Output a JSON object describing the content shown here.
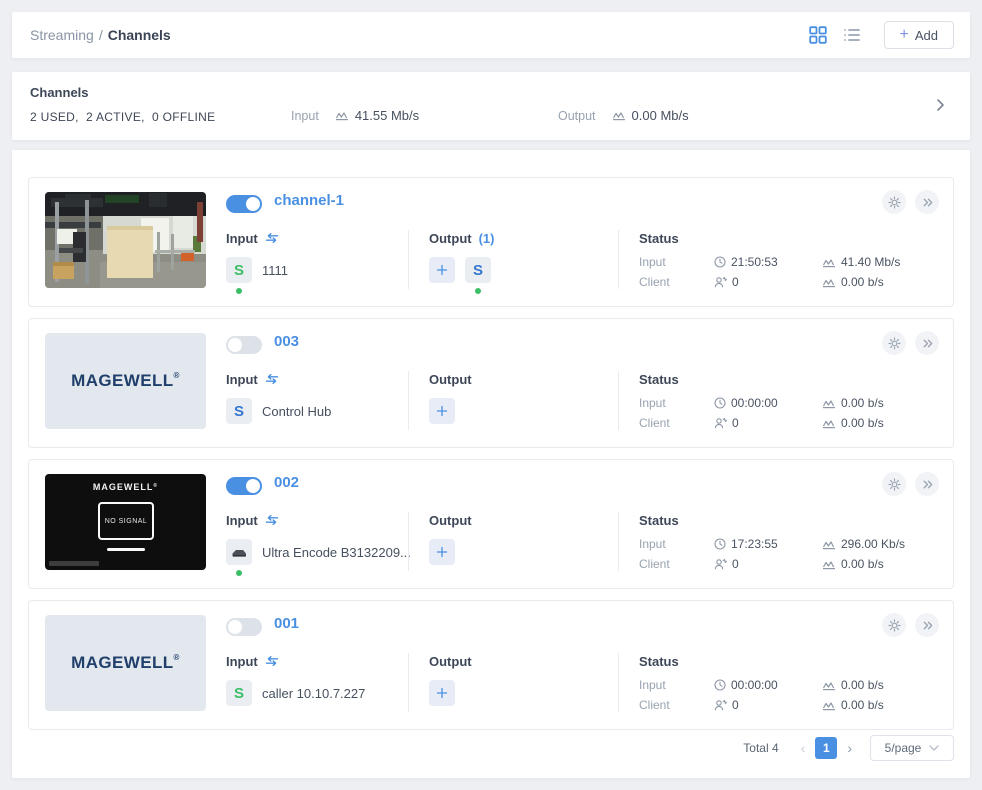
{
  "colors": {
    "accent": "#4a90e2",
    "green": "#3bbf66",
    "blue_s": "#3577d0",
    "page_bg": "#edeff3"
  },
  "topbar": {
    "breadcrumb_section": "Streaming",
    "breadcrumb_sep": "/",
    "breadcrumb_current": "Channels",
    "add_label": "Add",
    "add_plus": "+"
  },
  "summary": {
    "title": "Channels",
    "usage": "2 USED,  2 ACTIVE,  0 OFFLINE",
    "input_label": "Input",
    "input_rate": "41.55 Mb/s",
    "output_label": "Output",
    "output_rate": "0.00 Mb/s"
  },
  "labels": {
    "input": "Input",
    "output": "Output",
    "status": "Status",
    "status_input": "Input",
    "status_client": "Client"
  },
  "icons": {
    "srt_letter": "S"
  },
  "branding": {
    "brand": "MAGEWELL",
    "registered": "®",
    "no_signal": "NO SIGNAL"
  },
  "channels": [
    {
      "name": "channel-1",
      "enabled": true,
      "thumbnail": "photo",
      "input": {
        "icon": "srt-green",
        "label": "1111",
        "active": true
      },
      "output_count": "(1)",
      "outputs": [
        {
          "icon": "srt-blue",
          "active": true
        }
      ],
      "status": {
        "input_time": "21:50:53",
        "input_rate": "41.40 Mb/s",
        "clients": "0",
        "client_rate": "0.00 b/s"
      }
    },
    {
      "name": "003",
      "enabled": false,
      "thumbnail": "logo",
      "input": {
        "icon": "srt-blue",
        "label": "Control Hub",
        "active": false
      },
      "output_count": "",
      "outputs": [],
      "status": {
        "input_time": "00:00:00",
        "input_rate": "0.00 b/s",
        "clients": "0",
        "client_rate": "0.00 b/s"
      }
    },
    {
      "name": "002",
      "enabled": true,
      "thumbnail": "nosignal",
      "input": {
        "icon": "device",
        "label": "Ultra Encode B3132209...",
        "active": true
      },
      "output_count": "",
      "outputs": [],
      "status": {
        "input_time": "17:23:55",
        "input_rate": "296.00 Kb/s",
        "clients": "0",
        "client_rate": "0.00 b/s"
      }
    },
    {
      "name": "001",
      "enabled": false,
      "thumbnail": "logo",
      "input": {
        "icon": "srt-green",
        "label": "caller 10.10.7.227",
        "active": false
      },
      "output_count": "",
      "outputs": [],
      "status": {
        "input_time": "00:00:00",
        "input_rate": "0.00 b/s",
        "clients": "0",
        "client_rate": "0.00 b/s"
      }
    }
  ],
  "pagination": {
    "total": "Total 4",
    "page": "1",
    "page_size": "5/page",
    "prev": "‹",
    "next": "›"
  }
}
